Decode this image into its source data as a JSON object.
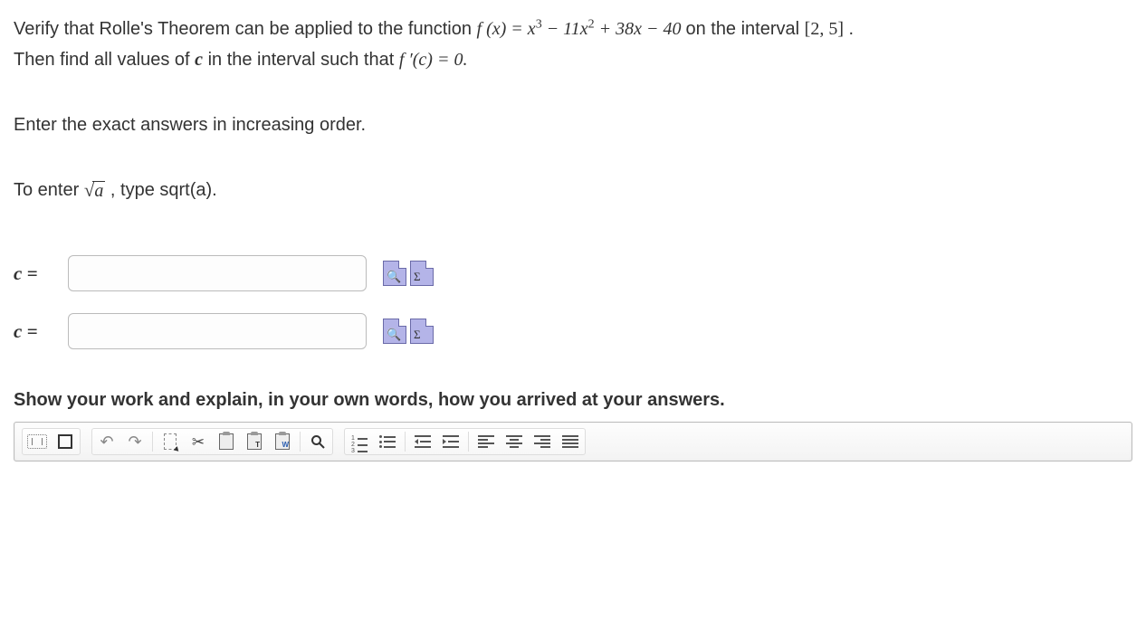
{
  "question": {
    "line1_pre": "Verify that Rolle's Theorem can be applied to the function ",
    "func_f_of_x": "f (x) = x",
    "exp3": "3",
    "minus_coef1": " − 11x",
    "exp2": "2",
    "rest_terms": " + 38x − 40",
    "line1_post_on": " on the interval ",
    "interval": "[2, 5]",
    "period1": ".",
    "line2_pre": "Then find all values of ",
    "c_var": "c",
    "line2_mid": " in the interval such that ",
    "fprime": "f ′(c) = 0.",
    "instr_order": "Enter the exact answers in increasing order.",
    "to_enter_pre": "To enter ",
    "sqrt_arg": "a",
    "to_enter_post": " , type sqrt(a)."
  },
  "answers": {
    "label": "c =",
    "value1": "",
    "value2": ""
  },
  "show_work": {
    "header": "Show your work and explain, in your own words, how you arrived at your answers."
  },
  "toolbar": {
    "groupA": [
      "source",
      "fullscreen"
    ],
    "groupB": [
      "undo",
      "redo",
      "sep",
      "select-all",
      "cut",
      "copy",
      "paste-text",
      "paste-word",
      "sep",
      "find"
    ],
    "groupC": [
      "ordered-list",
      "unordered-list",
      "sep",
      "outdent",
      "indent",
      "sep",
      "align-left",
      "align-center",
      "align-right",
      "align-justify"
    ]
  }
}
